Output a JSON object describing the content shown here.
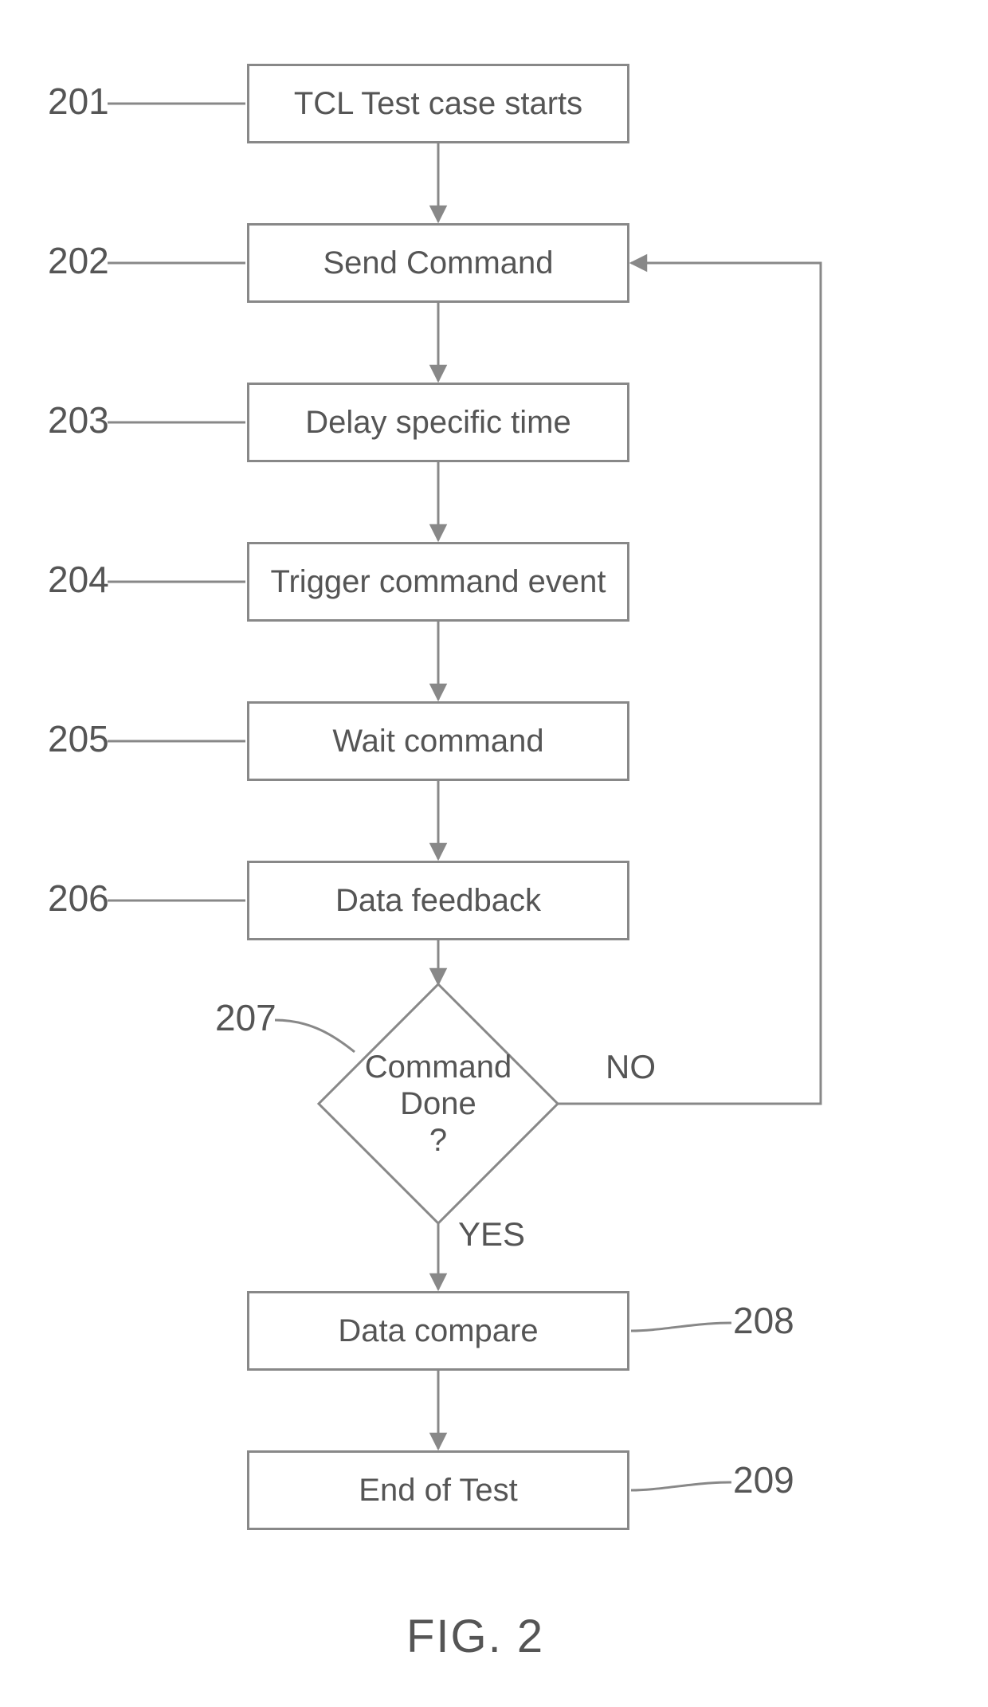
{
  "figure_caption": "FIG. 2",
  "steps": {
    "s201": {
      "num": "201",
      "text": "TCL Test case starts"
    },
    "s202": {
      "num": "202",
      "text": "Send Command"
    },
    "s203": {
      "num": "203",
      "text": "Delay specific time"
    },
    "s204": {
      "num": "204",
      "text": "Trigger command event"
    },
    "s205": {
      "num": "205",
      "text": "Wait command"
    },
    "s206": {
      "num": "206",
      "text": "Data feedback"
    },
    "s207": {
      "num": "207",
      "text_l1": "Command",
      "text_l2": "Done",
      "text_l3": "?"
    },
    "s208": {
      "num": "208",
      "text": "Data compare"
    },
    "s209": {
      "num": "209",
      "text": "End of Test"
    }
  },
  "edges": {
    "yes": "YES",
    "no": "NO"
  }
}
